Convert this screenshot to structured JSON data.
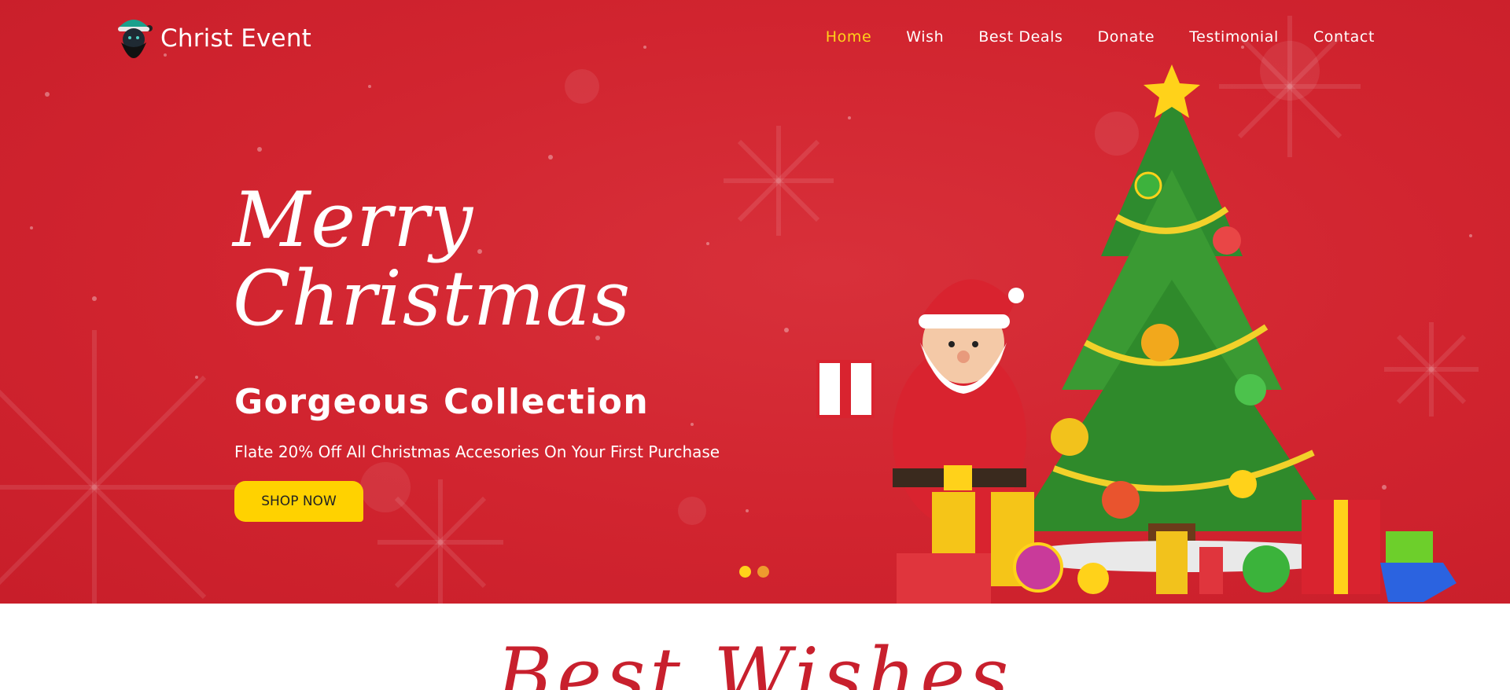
{
  "brand": {
    "name": "Christ Event",
    "logo_icon": "santa-icon"
  },
  "nav": {
    "items": [
      {
        "label": "Home",
        "active": true
      },
      {
        "label": "Wish",
        "active": false
      },
      {
        "label": "Best Deals",
        "active": false
      },
      {
        "label": "Donate",
        "active": false
      },
      {
        "label": "Testimonial",
        "active": false
      },
      {
        "label": "Contact",
        "active": false
      }
    ]
  },
  "hero": {
    "title_line1": "Merry",
    "title_line2": "Christmas",
    "subtitle": "Gorgeous Collection",
    "text": "Flate 20% Off All Christmas Accesories On Your First Purchase",
    "cta_label": "SHOP NOW",
    "slides": 2,
    "active_slide": 1,
    "illustration": "santa-christmas-tree-gifts"
  },
  "section": {
    "title": "Best Wishes"
  },
  "colors": {
    "hero_bg": "#d1242f",
    "accent": "#ffd21a",
    "nav_active": "#ffd21a",
    "section_title": "#c8202d"
  }
}
